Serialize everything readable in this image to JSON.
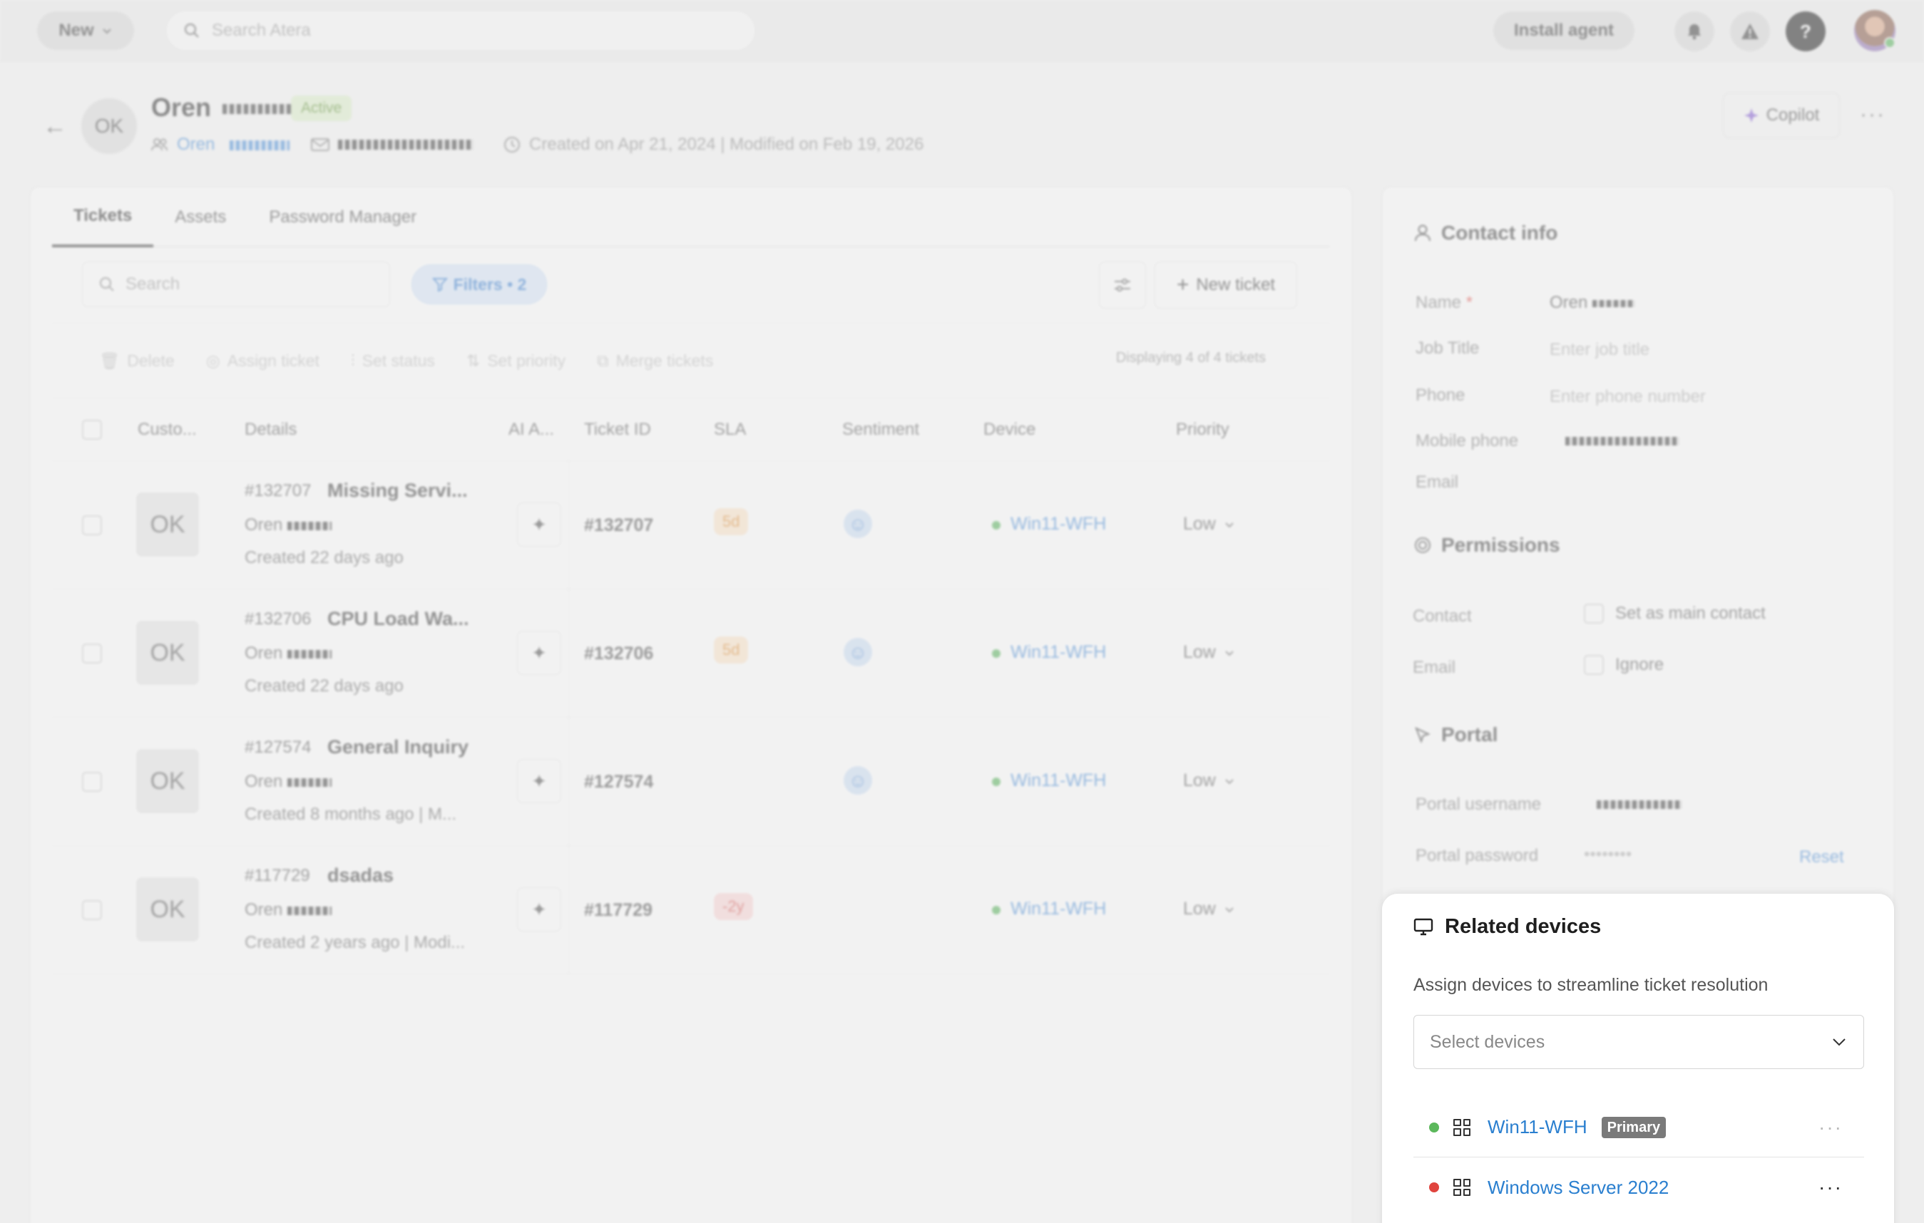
{
  "topbar": {
    "new_label": "New",
    "search_placeholder": "Search Atera",
    "install_label": "Install agent",
    "help_glyph": "?"
  },
  "contact": {
    "initials": "OK",
    "first_name": "Oren",
    "status": "Active",
    "customer_first": "Oren",
    "dates": "Created on Apr 21, 2024 | Modified on Feb 19, 2026",
    "copilot_label": "Copilot"
  },
  "tabs": [
    "Tickets",
    "Assets",
    "Password Manager"
  ],
  "toolbar": {
    "search_placeholder": "Search",
    "filters_label": "Filters • 2",
    "new_ticket_label": "New ticket"
  },
  "bulk_actions": [
    "Delete",
    "Assign ticket",
    "Set status",
    "Set priority",
    "Merge tickets"
  ],
  "displaying": "Displaying 4 of 4 tickets",
  "columns": [
    "Custo...",
    "Details",
    "AI A...",
    "Ticket ID",
    "SLA",
    "Sentiment",
    "Device",
    "Priority"
  ],
  "tickets": [
    {
      "avatar": "OK",
      "num": "#132707",
      "title": "Missing Servi...",
      "customer": "Oren",
      "created": "Created 22 days ago",
      "id": "#132707",
      "sla": "5d",
      "sla_color": "#e08a2b",
      "has_sentiment": true,
      "device": "Win11-WFH",
      "priority": "Low"
    },
    {
      "avatar": "OK",
      "num": "#132706",
      "title": "CPU Load Wa...",
      "customer": "Oren",
      "created": "Created 22 days ago",
      "id": "#132706",
      "sla": "5d",
      "sla_color": "#e08a2b",
      "has_sentiment": true,
      "device": "Win11-WFH",
      "priority": "Low"
    },
    {
      "avatar": "OK",
      "num": "#127574",
      "title": "General Inquiry",
      "customer": "Oren",
      "created": "Created 8 months ago | M...",
      "id": "#127574",
      "sla": "",
      "sla_color": "",
      "has_sentiment": true,
      "device": "Win11-WFH",
      "priority": "Low"
    },
    {
      "avatar": "OK",
      "num": "#117729",
      "title": "dsadas",
      "customer": "Oren",
      "created": "Created 2 years ago | Modi...",
      "id": "#117729",
      "sla": "-2y",
      "sla_color": "#d9534f",
      "has_sentiment": false,
      "device": "Win11-WFH",
      "priority": "Low"
    }
  ],
  "contact_info": {
    "heading": "Contact info",
    "name_label": "Name",
    "name_value": "Oren",
    "job_label": "Job Title",
    "job_placeholder": "Enter job title",
    "phone_label": "Phone",
    "phone_placeholder": "Enter phone number",
    "mobile_label": "Mobile phone",
    "email_label": "Email"
  },
  "permissions": {
    "heading": "Permissions",
    "contact_label": "Contact",
    "contact_option": "Set as main contact",
    "email_label": "Email",
    "email_option": "Ignore"
  },
  "portal": {
    "heading": "Portal",
    "username_label": "Portal username",
    "password_label": "Portal password",
    "password_mask": "••••••••",
    "reset_label": "Reset"
  },
  "related_devices": {
    "heading": "Related devices",
    "description": "Assign devices to streamline ticket resolution",
    "select_placeholder": "Select devices",
    "devices": [
      {
        "name": "Win11-WFH",
        "badge": "Primary",
        "status_color": "#5cb85c"
      },
      {
        "name": "Windows Server 2022",
        "badge": "",
        "status_color": "#e0443e"
      }
    ]
  }
}
